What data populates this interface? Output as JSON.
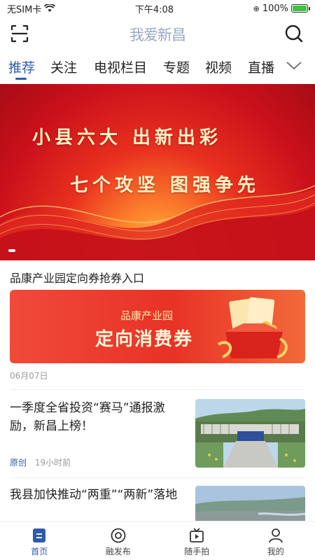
{
  "status_bar": {
    "carrier": "无SIM卡",
    "time": "下午4:08",
    "battery": "100%"
  },
  "header": {
    "logo_text": "我爱新昌"
  },
  "tabs": [
    {
      "label": "推荐",
      "active": true
    },
    {
      "label": "关注"
    },
    {
      "label": "电视栏目"
    },
    {
      "label": "专题"
    },
    {
      "label": "视频"
    },
    {
      "label": "直播"
    }
  ],
  "banner": {
    "line1": "小县六大 出新出彩",
    "line2": "七个攻坚 图强争先"
  },
  "ad": {
    "title": "品康产业园定向券抢券入口",
    "card_sub": "品康产业园",
    "card_main": "定向消费券",
    "date": "06月07日"
  },
  "news": [
    {
      "title": "一季度全省投资“赛马”通报激励，新昌上榜！",
      "tag": "原创",
      "time": "19小时前"
    },
    {
      "title": "我县加快推动“两重”“两新”落地"
    }
  ],
  "bottom_nav": [
    {
      "label": "首页",
      "icon": "home-icon",
      "active": true
    },
    {
      "label": "融发布",
      "icon": "target-icon"
    },
    {
      "label": "随手拍",
      "icon": "tv-icon"
    },
    {
      "label": "我的",
      "icon": "user-icon"
    }
  ],
  "colors": {
    "accent": "#2f5ba8",
    "banner_red": "#d9201e"
  }
}
